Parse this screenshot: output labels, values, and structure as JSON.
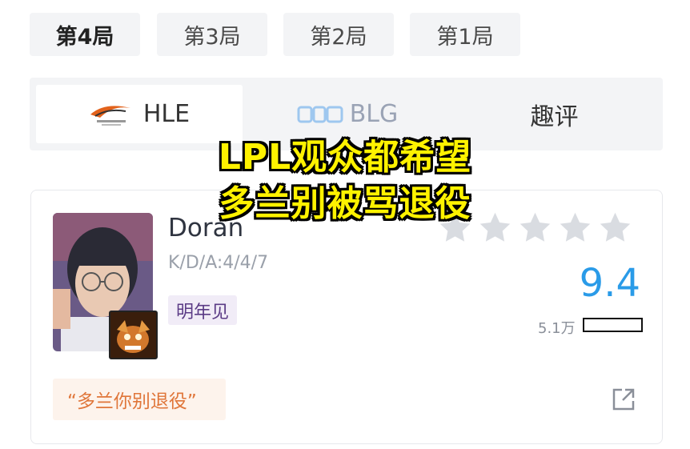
{
  "games": {
    "tabs": [
      {
        "label": "第4局",
        "active": true
      },
      {
        "label": "第3局",
        "active": false
      },
      {
        "label": "第2局",
        "active": false
      },
      {
        "label": "第1局",
        "active": false
      }
    ]
  },
  "teams": {
    "hle": {
      "logo_icon": "hle-logo-icon",
      "logo_text": "Hanwha Life Esports",
      "name": "HLE"
    },
    "blg": {
      "logo_icon": "blg-logo-icon",
      "logo_text": "BLG",
      "name": "BLG"
    },
    "comments_tab": "趣评"
  },
  "overlay": {
    "line1": "LPL观众都希望",
    "line2": "多兰别被骂退役"
  },
  "player": {
    "name": "Doran",
    "kda": "K/D/A:4/4/7",
    "tag": "明年见",
    "stars_total": 5,
    "stars_filled": 0,
    "score": "9.4",
    "votes": "5.1万",
    "comment": "“多兰你别退役”",
    "colors": {
      "score": "#2a9be8",
      "star": "#d9dce1",
      "comment": "#e0763a",
      "tag": "#5b3b86"
    }
  }
}
